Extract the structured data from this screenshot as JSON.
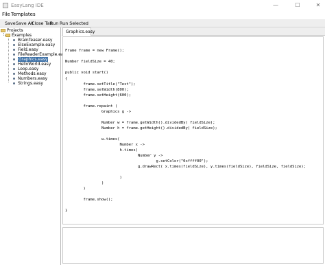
{
  "window": {
    "title": "EasyLang IDE",
    "minimize_glyph": "—",
    "maximize_glyph": "☐",
    "close_glyph": "✕"
  },
  "menubar": {
    "items": [
      "File",
      "Templates"
    ]
  },
  "toolbar": {
    "items": [
      "Save",
      "Save All",
      "Close Tab",
      "Run",
      "Run Selected"
    ]
  },
  "tree": {
    "root": "Projects",
    "folder": "Examples",
    "files": [
      "BrainTeaser.easy",
      "ElseExample.easy",
      "Field.easy",
      "FileReaderExample.easy",
      "Graphics.easy",
      "HelloWorld.easy",
      "Loop.easy",
      "Methods.easy",
      "Numbers.easy",
      "Strings.easy"
    ],
    "selected": "Graphics.easy"
  },
  "tabs": [
    "Graphics.easy"
  ],
  "code": [
    "",
    "Frame frame = new Frame();",
    "",
    "Number fieldSize = 40;",
    "",
    "public void start()",
    "{",
    "        frame.setTitle(\"Test\");",
    "        frame.setWidth(800);",
    "        frame.setHeight(600);",
    "",
    "        frame.repaint (",
    "                Graphics g ->",
    "",
    "                Number w = frame.getWidth().dividedBy( fieldSize);",
    "                Number h = frame.getHeight().dividedBy( fieldSize);",
    "",
    "                w.times(",
    "                        Number x ->",
    "                        h.times(",
    "                                Number y ->",
    "                                        g.setColor(\"0xffff00\");",
    "                                g.drawRect( x.times(fieldSize), y.times(fieldSize), fieldSize, fieldSize);",
    "",
    "                        )",
    "                )",
    "        )",
    "",
    "        frame.show();",
    "",
    "}"
  ]
}
